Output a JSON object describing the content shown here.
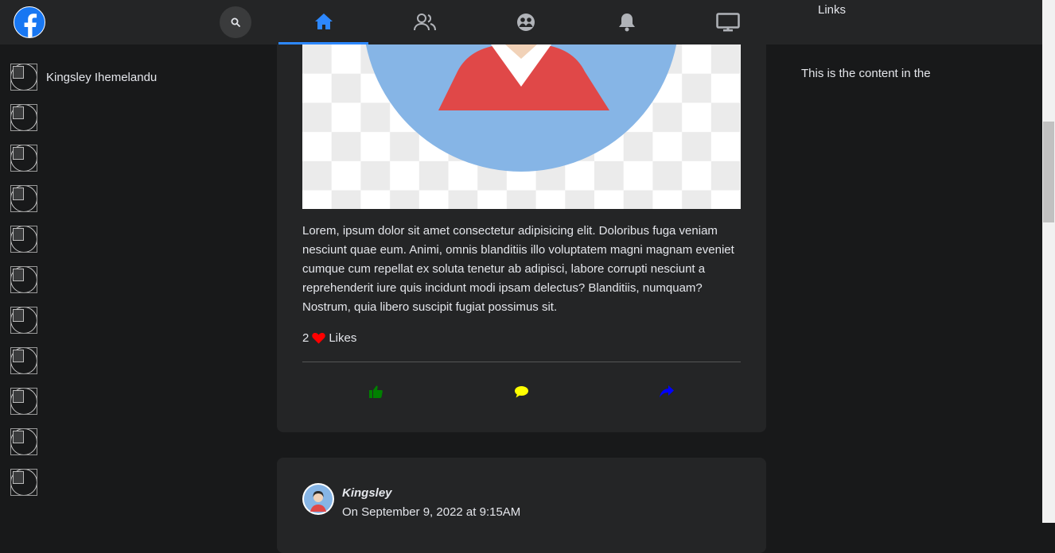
{
  "topbar": {
    "logo_icon": "facebook-logo-icon",
    "search_icon": "search-icon",
    "tabs": [
      {
        "name": "home",
        "icon": "home-icon",
        "active": true
      },
      {
        "name": "friends",
        "icon": "friends-icon",
        "active": false
      },
      {
        "name": "groups",
        "icon": "groups-icon",
        "active": false
      },
      {
        "name": "notifications",
        "icon": "bell-icon",
        "active": false
      },
      {
        "name": "watch",
        "icon": "monitor-icon",
        "active": false
      }
    ],
    "links_title": "Links"
  },
  "sidebar": {
    "items": [
      {
        "label": "Kingsley Ihemelandu"
      },
      {
        "label": ""
      },
      {
        "label": ""
      },
      {
        "label": ""
      },
      {
        "label": ""
      },
      {
        "label": ""
      },
      {
        "label": ""
      },
      {
        "label": ""
      },
      {
        "label": ""
      },
      {
        "label": ""
      },
      {
        "label": ""
      }
    ]
  },
  "feed": {
    "post1": {
      "text": "Lorem, ipsum dolor sit amet consectetur adipisicing elit. Doloribus fuga veniam nesciunt quae eum. Animi, omnis blanditiis illo voluptatem magni magnam eveniet cumque cum repellat ex soluta tenetur ab adipisci, labore corrupti nesciunt a reprehenderit iure quis incidunt modi ipsam delectus? Blanditiis, numquam? Nostrum, quia libero suscipit fugiat possimus sit.",
      "likes_count": "2",
      "likes_label": "Likes",
      "actions": [
        {
          "name": "like",
          "icon": "thumbs-up-icon",
          "color": "#008000"
        },
        {
          "name": "comment",
          "icon": "comment-icon",
          "color": "#ffff00"
        },
        {
          "name": "share",
          "icon": "share-icon",
          "color": "#0000ff"
        }
      ]
    },
    "post2": {
      "author": "Kingsley",
      "date": "On September 9, 2022 at 9:15AM"
    }
  },
  "right_panel": {
    "content": "This is the content in the"
  },
  "colors": {
    "background": "#18191a",
    "surface": "#242526",
    "accent": "#2d88ff",
    "heart": "#ff0000"
  }
}
